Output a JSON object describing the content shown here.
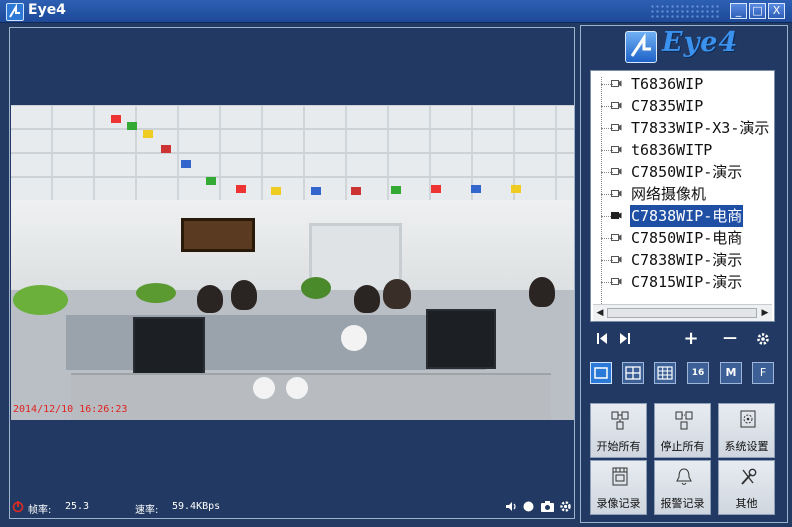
{
  "window": {
    "title": "Eye4",
    "controls": {
      "minimize": "_",
      "maximize": "□",
      "close": "X"
    }
  },
  "logo": {
    "text": "Eye4"
  },
  "video": {
    "timestamp": "2014/12/10 16:26:23"
  },
  "status": {
    "fps_label": "帧率:",
    "fps_value": "25.3",
    "rate_label": "速率:",
    "rate_value": "59.4KBps"
  },
  "devices": [
    {
      "label": "T6836WIP"
    },
    {
      "label": "C7835WIP"
    },
    {
      "label": "T7833WIP-X3-演示"
    },
    {
      "label": "t6836WITP"
    },
    {
      "label": "C7850WIP-演示"
    },
    {
      "label": "网络摄像机"
    },
    {
      "label": "C7838WIP-电商"
    },
    {
      "label": "C7850WIP-电商"
    },
    {
      "label": "C7838WIP-演示"
    },
    {
      "label": "C7815WIP-演示"
    }
  ],
  "selected_device": "C7838WIP-电商",
  "controls": {
    "prev": "◀",
    "next": "▶",
    "add": "+",
    "remove": "—",
    "settings": "gear-icon"
  },
  "layouts": [
    {
      "label": ""
    },
    {
      "label": ""
    },
    {
      "label": ""
    },
    {
      "label": "16"
    },
    {
      "label": "M"
    },
    {
      "label": "F"
    }
  ],
  "actions": [
    {
      "label": "开始所有",
      "icon": "start-all-icon"
    },
    {
      "label": "停止所有",
      "icon": "stop-all-icon"
    },
    {
      "label": "系统设置",
      "icon": "system-settings-icon"
    },
    {
      "label": "录像记录",
      "icon": "record-log-icon"
    },
    {
      "label": "报警记录",
      "icon": "alarm-bell-icon"
    },
    {
      "label": "其他",
      "icon": "tools-icon"
    }
  ],
  "colors": {
    "background": "#233a63",
    "selection": "#1f4fa5",
    "timestamp": "#e0221f",
    "logo": "#3b92ee"
  }
}
